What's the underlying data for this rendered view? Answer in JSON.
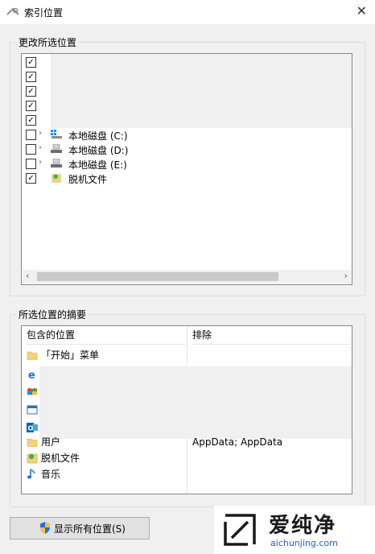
{
  "window": {
    "title": "索引位置"
  },
  "change_section": {
    "label": "更改所选位置",
    "items": [
      {
        "checked": true,
        "label": ""
      },
      {
        "checked": true,
        "label": ""
      },
      {
        "checked": true,
        "label": ""
      },
      {
        "checked": true,
        "label": ""
      },
      {
        "checked": true,
        "label": ""
      },
      {
        "checked": false,
        "label": "本地磁盘 (C:)",
        "icon": "local-disk-windows-icon"
      },
      {
        "checked": false,
        "label": "本地磁盘 (D:)",
        "icon": "local-disk-icon"
      },
      {
        "checked": false,
        "label": "本地磁盘 (E:)",
        "icon": "local-disk-icon"
      },
      {
        "checked": true,
        "label": "脱机文件",
        "icon": "offline-files-icon"
      }
    ]
  },
  "summary_section": {
    "label": "所选位置的摘要",
    "col_included": "包含的位置",
    "col_excluded": "排除",
    "rows": [
      {
        "label": "「开始」菜单",
        "excluded": "",
        "icon": "folder-icon"
      },
      {
        "label": "",
        "excluded": "",
        "icon": "ie-icon"
      },
      {
        "label": "",
        "excluded": "",
        "icon": "windows-flag-icon"
      },
      {
        "label": "",
        "excluded": "",
        "icon": "window-app-icon"
      },
      {
        "label": "",
        "excluded": "",
        "icon": "outlook-icon"
      },
      {
        "label": "用户",
        "excluded": "AppData; AppData",
        "icon": "folder-icon"
      },
      {
        "label": "脱机文件",
        "excluded": "",
        "icon": "offline-files-icon"
      },
      {
        "label": "音乐",
        "excluded": "",
        "icon": "music-note-icon"
      }
    ]
  },
  "buttons": {
    "show_all": "显示所有位置(S)"
  },
  "watermark": {
    "brand": "爱纯净",
    "url": "aichunjing.com"
  },
  "colors": {
    "accent": "#1a5fc9",
    "border": "#828790"
  }
}
